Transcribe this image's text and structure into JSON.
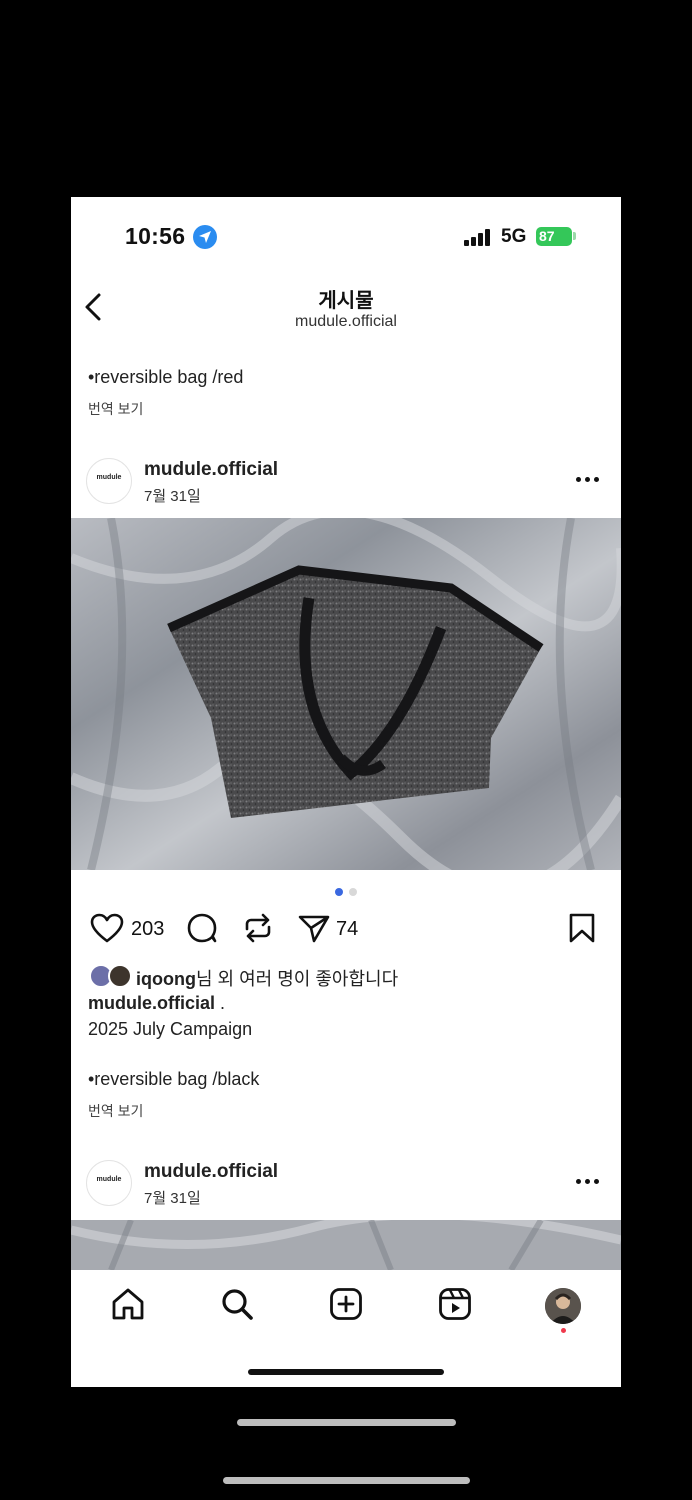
{
  "status_bar": {
    "time": "10:56",
    "network": "5G",
    "battery": "87"
  },
  "header": {
    "title": "게시물",
    "subtitle": "mudule.official"
  },
  "prev_post": {
    "caption_line": "•reversible bag /red",
    "translate": "번역 보기"
  },
  "post": {
    "avatar_text": "mudule",
    "username": "mudule.official",
    "date": "7월 31일",
    "likes_count": "203",
    "shares_count": "74",
    "liked_by_user": "iqoong",
    "liked_by_rest": "님 외 여러 명이 좋아합니다",
    "caption_user": "mudule.official",
    "caption_suffix": " .",
    "caption_line1": "2025 July Campaign",
    "caption_line2": "•reversible bag /black",
    "translate": "번역 보기",
    "carousel_index": 1,
    "carousel_total": 2
  },
  "next_post": {
    "avatar_text": "mudule",
    "username": "mudule.official",
    "date": "7월 31일"
  },
  "icons": {
    "back": "chevron-left-icon",
    "more": "more-horizontal-icon",
    "like": "heart-icon",
    "comment": "comment-icon",
    "repost": "repost-icon",
    "share": "send-icon",
    "save": "bookmark-icon",
    "home": "home-icon",
    "search": "search-icon",
    "create": "plus-square-icon",
    "reels": "reels-icon"
  },
  "colors": {
    "accent": "#3a68e0",
    "battery": "#34c759",
    "notification": "#ef3a4d"
  }
}
